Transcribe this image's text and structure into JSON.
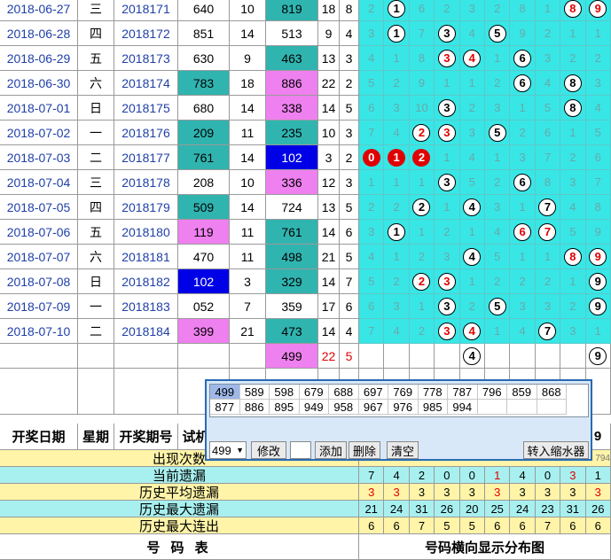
{
  "draws": [
    {
      "date": "2018-06-27",
      "wk": "三",
      "no": "2018171",
      "a": "640",
      "a_bg": "",
      "b": "10",
      "c": "819",
      "c_bg": "teal",
      "d": "18",
      "e": "8",
      "dist": [
        "2",
        "1",
        "6",
        "2",
        "3",
        "2",
        "8",
        "1",
        "8",
        "9"
      ],
      "dstyle": [
        "g",
        "w",
        "g",
        "g",
        "g",
        "g",
        "g",
        "g",
        "wr",
        "wr"
      ]
    },
    {
      "date": "2018-06-28",
      "wk": "四",
      "no": "2018172",
      "a": "851",
      "a_bg": "",
      "b": "14",
      "c": "513",
      "c_bg": "",
      "d": "9",
      "e": "4",
      "dist": [
        "3",
        "1",
        "7",
        "3",
        "4",
        "5",
        "9",
        "2",
        "1",
        "1"
      ],
      "dstyle": [
        "g",
        "w",
        "g",
        "w",
        "g",
        "w",
        "g",
        "g",
        "g",
        "g"
      ]
    },
    {
      "date": "2018-06-29",
      "wk": "五",
      "no": "2018173",
      "a": "630",
      "a_bg": "",
      "b": "9",
      "c": "463",
      "c_bg": "teal",
      "d": "13",
      "e": "3",
      "dist": [
        "4",
        "1",
        "8",
        "3",
        "4",
        "1",
        "6",
        "3",
        "2",
        "2"
      ],
      "dstyle": [
        "g",
        "g",
        "g",
        "wr",
        "wr",
        "g",
        "w",
        "g",
        "g",
        "g"
      ]
    },
    {
      "date": "2018-06-30",
      "wk": "六",
      "no": "2018174",
      "a": "783",
      "a_bg": "teal",
      "b": "18",
      "c": "886",
      "c_bg": "pink",
      "d": "22",
      "e": "2",
      "dist": [
        "5",
        "2",
        "9",
        "1",
        "1",
        "2",
        "6",
        "4",
        "8",
        "3"
      ],
      "dstyle": [
        "g",
        "g",
        "g",
        "g",
        "g",
        "g",
        "w",
        "g",
        "w",
        "g"
      ]
    },
    {
      "date": "2018-07-01",
      "wk": "日",
      "no": "2018175",
      "a": "680",
      "a_bg": "",
      "b": "14",
      "c": "338",
      "c_bg": "pink",
      "d": "14",
      "e": "5",
      "dist": [
        "6",
        "3",
        "10",
        "3",
        "2",
        "3",
        "1",
        "5",
        "8",
        "4"
      ],
      "dstyle": [
        "g",
        "g",
        "g",
        "w",
        "g",
        "g",
        "g",
        "g",
        "w",
        "g"
      ]
    },
    {
      "date": "2018-07-02",
      "wk": "一",
      "no": "2018176",
      "a": "209",
      "a_bg": "teal",
      "b": "11",
      "c": "235",
      "c_bg": "teal",
      "d": "10",
      "e": "3",
      "dist": [
        "7",
        "4",
        "2",
        "3",
        "3",
        "5",
        "2",
        "6",
        "1",
        "5"
      ],
      "dstyle": [
        "g",
        "g",
        "wr",
        "wr",
        "g",
        "w",
        "g",
        "g",
        "g",
        "g"
      ]
    },
    {
      "date": "2018-07-03",
      "wk": "二",
      "no": "2018177",
      "a": "761",
      "a_bg": "teal",
      "b": "14",
      "c": "102",
      "c_bg": "blue",
      "d": "3",
      "e": "2",
      "dist": [
        "0",
        "1",
        "2",
        "1",
        "4",
        "1",
        "3",
        "7",
        "2",
        "6"
      ],
      "dstyle": [
        "r",
        "r",
        "r",
        "g",
        "g",
        "g",
        "g",
        "g",
        "g",
        "g"
      ]
    },
    {
      "date": "2018-07-04",
      "wk": "三",
      "no": "2018178",
      "a": "208",
      "a_bg": "",
      "b": "10",
      "c": "336",
      "c_bg": "pink",
      "d": "12",
      "e": "3",
      "dist": [
        "1",
        "1",
        "1",
        "3",
        "5",
        "2",
        "6",
        "8",
        "3",
        "7"
      ],
      "dstyle": [
        "g",
        "g",
        "g",
        "w",
        "g",
        "g",
        "w",
        "g",
        "g",
        "g"
      ]
    },
    {
      "date": "2018-07-05",
      "wk": "四",
      "no": "2018179",
      "a": "509",
      "a_bg": "teal",
      "b": "14",
      "c": "724",
      "c_bg": "",
      "d": "13",
      "e": "5",
      "dist": [
        "2",
        "2",
        "2",
        "1",
        "4",
        "3",
        "1",
        "7",
        "4",
        "8"
      ],
      "dstyle": [
        "g",
        "g",
        "w",
        "g",
        "w",
        "g",
        "g",
        "w",
        "g",
        "g"
      ]
    },
    {
      "date": "2018-07-06",
      "wk": "五",
      "no": "2018180",
      "a": "119",
      "a_bg": "pink",
      "b": "11",
      "c": "761",
      "c_bg": "teal",
      "d": "14",
      "e": "6",
      "dist": [
        "3",
        "1",
        "1",
        "2",
        "1",
        "4",
        "6",
        "7",
        "5",
        "9"
      ],
      "dstyle": [
        "g",
        "w",
        "g",
        "g",
        "g",
        "g",
        "wr",
        "wr",
        "g",
        "g"
      ]
    },
    {
      "date": "2018-07-07",
      "wk": "六",
      "no": "2018181",
      "a": "470",
      "a_bg": "",
      "b": "11",
      "c": "498",
      "c_bg": "teal",
      "d": "21",
      "e": "5",
      "dist": [
        "4",
        "1",
        "2",
        "3",
        "4",
        "5",
        "1",
        "1",
        "8",
        "9"
      ],
      "dstyle": [
        "g",
        "g",
        "g",
        "g",
        "w",
        "g",
        "g",
        "g",
        "wr",
        "wr"
      ]
    },
    {
      "date": "2018-07-08",
      "wk": "日",
      "no": "2018182",
      "a": "102",
      "a_bg": "blue",
      "b": "3",
      "c": "329",
      "c_bg": "teal",
      "d": "14",
      "e": "7",
      "dist": [
        "5",
        "2",
        "2",
        "3",
        "1",
        "2",
        "2",
        "2",
        "1",
        "9"
      ],
      "dstyle": [
        "g",
        "g",
        "wr",
        "wr",
        "g",
        "g",
        "g",
        "g",
        "g",
        "w"
      ]
    },
    {
      "date": "2018-07-09",
      "wk": "一",
      "no": "2018183",
      "a": "052",
      "a_bg": "",
      "b": "7",
      "c": "359",
      "c_bg": "",
      "d": "17",
      "e": "6",
      "dist": [
        "6",
        "3",
        "1",
        "3",
        "2",
        "5",
        "3",
        "3",
        "2",
        "9"
      ],
      "dstyle": [
        "g",
        "g",
        "g",
        "w",
        "g",
        "w",
        "g",
        "g",
        "g",
        "w"
      ]
    },
    {
      "date": "2018-07-10",
      "wk": "二",
      "no": "2018184",
      "a": "399",
      "a_bg": "pink",
      "b": "21",
      "c": "473",
      "c_bg": "teal",
      "d": "14",
      "e": "4",
      "dist": [
        "7",
        "4",
        "2",
        "3",
        "4",
        "1",
        "4",
        "7",
        "3",
        "1"
      ],
      "dstyle": [
        "g",
        "g",
        "g",
        "wr",
        "wr",
        "g",
        "g",
        "w",
        "g",
        "g"
      ]
    }
  ],
  "next_row": {
    "c": "499",
    "d": "22",
    "e": "5",
    "balls": {
      "4": "4",
      "9": "9"
    }
  },
  "header": {
    "date": "开奖日期",
    "wk": "星期",
    "no": "开奖期号",
    "a": "试机",
    "last": "9"
  },
  "stats": {
    "labels": [
      "出现次数",
      "当前遗漏",
      "历史平均遗漏",
      "历史最大遗漏",
      "历史最大连出"
    ],
    "appear_tail": "794",
    "cur": [
      "7",
      "4",
      "2",
      "0",
      "0",
      "1",
      "4",
      "0",
      "3",
      "1"
    ],
    "cur_red": [
      false,
      false,
      false,
      false,
      false,
      true,
      false,
      false,
      true,
      false
    ],
    "avg": [
      "3",
      "3",
      "3",
      "3",
      "3",
      "3",
      "3",
      "3",
      "3",
      "3"
    ],
    "avg_red": [
      true,
      true,
      false,
      false,
      false,
      true,
      false,
      false,
      false,
      true
    ],
    "maxmiss": [
      "21",
      "24",
      "31",
      "26",
      "20",
      "25",
      "24",
      "23",
      "31",
      "26"
    ],
    "maxrun": [
      "6",
      "6",
      "7",
      "5",
      "5",
      "6",
      "6",
      "7",
      "6",
      "6"
    ]
  },
  "footer": {
    "left": "号 码 表",
    "right": "号码横向显示分布图"
  },
  "popup": {
    "row1": [
      "499",
      "589",
      "598",
      "679",
      "688",
      "697",
      "769",
      "778",
      "787",
      "796",
      "859",
      "868"
    ],
    "row2": [
      "877",
      "886",
      "895",
      "949",
      "958",
      "967",
      "976",
      "985",
      "994"
    ],
    "select_value": "499",
    "buttons": {
      "edit": "修改",
      "add": "添加",
      "delete": "删除",
      "clear": "清空",
      "transfer": "转入缩水器"
    }
  }
}
